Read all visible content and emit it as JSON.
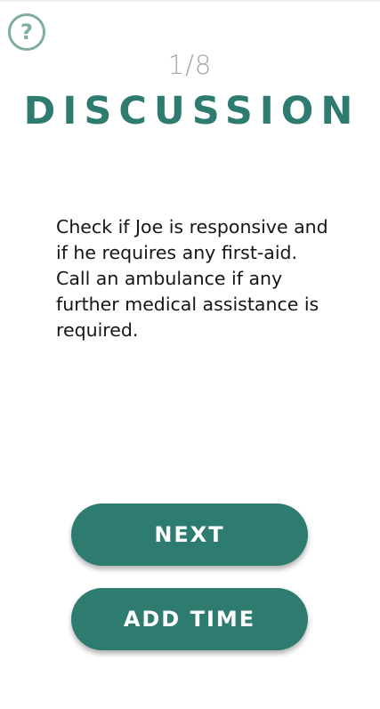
{
  "help": {
    "icon": "question-mark-icon",
    "glyph": "?"
  },
  "header": {
    "step": "1/8",
    "title": "DISCUSSION"
  },
  "content": {
    "text": "Check if Joe is responsive and if he requires any first-aid. Call an ambulance if any further medical assistance is required."
  },
  "actions": {
    "next_label": "NEXT",
    "add_time_label": "ADD TIME"
  },
  "colors": {
    "accent": "#2e7b70",
    "help_ring": "#7fae99",
    "step_text": "#a6a6a6",
    "body_text": "#151515"
  }
}
